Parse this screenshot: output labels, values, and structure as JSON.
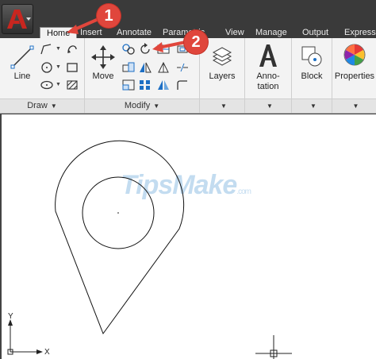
{
  "tabs": [
    {
      "label": "Home",
      "active": true
    },
    {
      "label": "Insert"
    },
    {
      "label": "Annotate"
    },
    {
      "label": "Parametric"
    },
    {
      "label": "View"
    },
    {
      "label": "Manage"
    },
    {
      "label": "Output"
    },
    {
      "label": "Express"
    }
  ],
  "ribbon": {
    "draw": {
      "title": "Draw",
      "line_label": "Line"
    },
    "modify": {
      "title": "Modify",
      "move_label": "Move"
    },
    "layers_label": "Layers",
    "annotation_label_1": "Anno-",
    "annotation_label_2": "tation",
    "block_label": "Block",
    "properties_label": "Properties"
  },
  "callouts": [
    "1",
    "2"
  ],
  "canvas": {
    "watermark": "TipsMake",
    "watermark_suffix": ".com",
    "ucs_x_label": "X",
    "ucs_y_label": "Y"
  },
  "colors": {
    "tab_bar": "#3a3a3a",
    "ribbon_bg": "#f3f3f3",
    "callout": "#e0463c",
    "app_logo_red": "#c8261f"
  }
}
